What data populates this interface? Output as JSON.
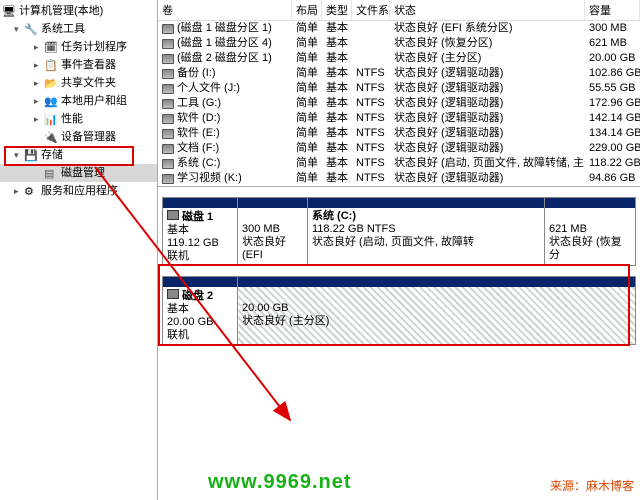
{
  "tree": {
    "root": "计算机管理(本地)",
    "sys_tools": "系统工具",
    "task": "任务计划程序",
    "event": "事件查看器",
    "share": "共享文件夹",
    "users": "本地用户和组",
    "perf": "性能",
    "device": "设备管理器",
    "storage": "存储",
    "diskmgmt": "磁盘管理",
    "services": "服务和应用程序"
  },
  "headers": {
    "volume": "卷",
    "layout": "布局",
    "type": "类型",
    "fs": "文件系统",
    "status": "状态",
    "capacity": "容量"
  },
  "volumes": [
    {
      "name": "(磁盘 1 磁盘分区 1)",
      "layout": "简单",
      "type": "基本",
      "fs": "",
      "status": "状态良好 (EFI 系统分区)",
      "cap": "300 MB"
    },
    {
      "name": "(磁盘 1 磁盘分区 4)",
      "layout": "简单",
      "type": "基本",
      "fs": "",
      "status": "状态良好 (恢复分区)",
      "cap": "621 MB"
    },
    {
      "name": "(磁盘 2 磁盘分区 1)",
      "layout": "简单",
      "type": "基本",
      "fs": "",
      "status": "状态良好 (主分区)",
      "cap": "20.00 GB"
    },
    {
      "name": "备份 (I:)",
      "layout": "简单",
      "type": "基本",
      "fs": "NTFS",
      "status": "状态良好 (逻辑驱动器)",
      "cap": "102.86 GB"
    },
    {
      "name": "个人文件 (J:)",
      "layout": "简单",
      "type": "基本",
      "fs": "NTFS",
      "status": "状态良好 (逻辑驱动器)",
      "cap": "55.55 GB"
    },
    {
      "name": "工具 (G:)",
      "layout": "简单",
      "type": "基本",
      "fs": "NTFS",
      "status": "状态良好 (逻辑驱动器)",
      "cap": "172.96 GB"
    },
    {
      "name": "软件 (D:)",
      "layout": "简单",
      "type": "基本",
      "fs": "NTFS",
      "status": "状态良好 (逻辑驱动器)",
      "cap": "142.14 GB"
    },
    {
      "name": "软件 (E:)",
      "layout": "简单",
      "type": "基本",
      "fs": "NTFS",
      "status": "状态良好 (逻辑驱动器)",
      "cap": "134.14 GB"
    },
    {
      "name": "文档 (F:)",
      "layout": "简单",
      "type": "基本",
      "fs": "NTFS",
      "status": "状态良好 (逻辑驱动器)",
      "cap": "229.00 GB"
    },
    {
      "name": "系统 (C:)",
      "layout": "简单",
      "type": "基本",
      "fs": "NTFS",
      "status": "状态良好 (启动, 页面文件, 故障转储, 主分区)",
      "cap": "118.22 GB"
    },
    {
      "name": "学习视频 (K:)",
      "layout": "简单",
      "type": "基本",
      "fs": "NTFS",
      "status": "状态良好 (逻辑驱动器)",
      "cap": "94.86 GB"
    }
  ],
  "disk1": {
    "title": "磁盘 1",
    "type": "基本",
    "size": "119.12 GB",
    "status": "联机",
    "p1": {
      "size": "300 MB",
      "status": "状态良好 (EFI "
    },
    "p2": {
      "title": "系统  (C:)",
      "size": "118.22 GB NTFS",
      "status": "状态良好 (启动, 页面文件, 故障转"
    },
    "p3": {
      "size": "621 MB",
      "status": "状态良好 (恢复分"
    }
  },
  "disk2": {
    "title": "磁盘 2",
    "type": "基本",
    "size": "20.00 GB",
    "status": "联机",
    "p1": {
      "size": "20.00 GB",
      "status": "状态良好 (主分区)"
    }
  },
  "watermark": "www.9969.net",
  "source": "来源：麻木博客"
}
